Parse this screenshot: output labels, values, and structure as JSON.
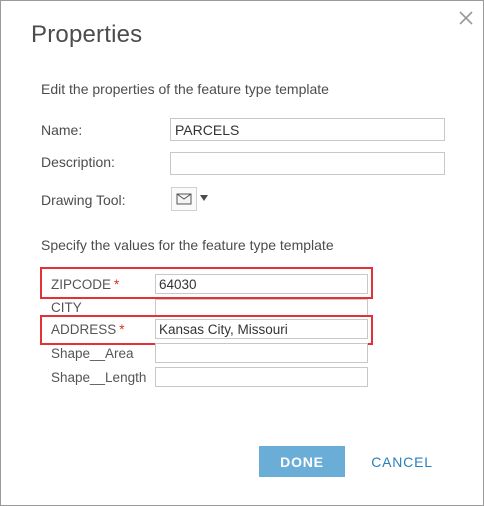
{
  "dialog": {
    "title": "Properties",
    "close_icon": "close-icon",
    "intro": "Edit the properties of the feature type template",
    "name_label": "Name:",
    "name_value": "PARCELS",
    "description_label": "Description:",
    "description_value": "",
    "drawing_tool_label": "Drawing Tool:",
    "drawing_tool_icon": "polygon-icon",
    "drawing_tool_caret_icon": "caret-down-icon",
    "values_intro": "Specify the values for the feature type template",
    "fields": [
      {
        "label": "ZIPCODE",
        "required": true,
        "required_mark": "*",
        "value": "64030"
      },
      {
        "label": "CITY",
        "required": false,
        "value": ""
      },
      {
        "label": "ADDRESS",
        "required": true,
        "required_mark": "*",
        "value": "Kansas City, Missouri"
      },
      {
        "label": "Shape__Area",
        "required": false,
        "value": ""
      },
      {
        "label": "Shape__Length",
        "required": false,
        "value": ""
      }
    ],
    "done_label": "DONE",
    "cancel_label": "CANCEL"
  },
  "colors": {
    "highlight": "#e23137",
    "done_bg": "#6aaed8",
    "cancel_text": "#2b7fba",
    "required": "#d83020"
  }
}
